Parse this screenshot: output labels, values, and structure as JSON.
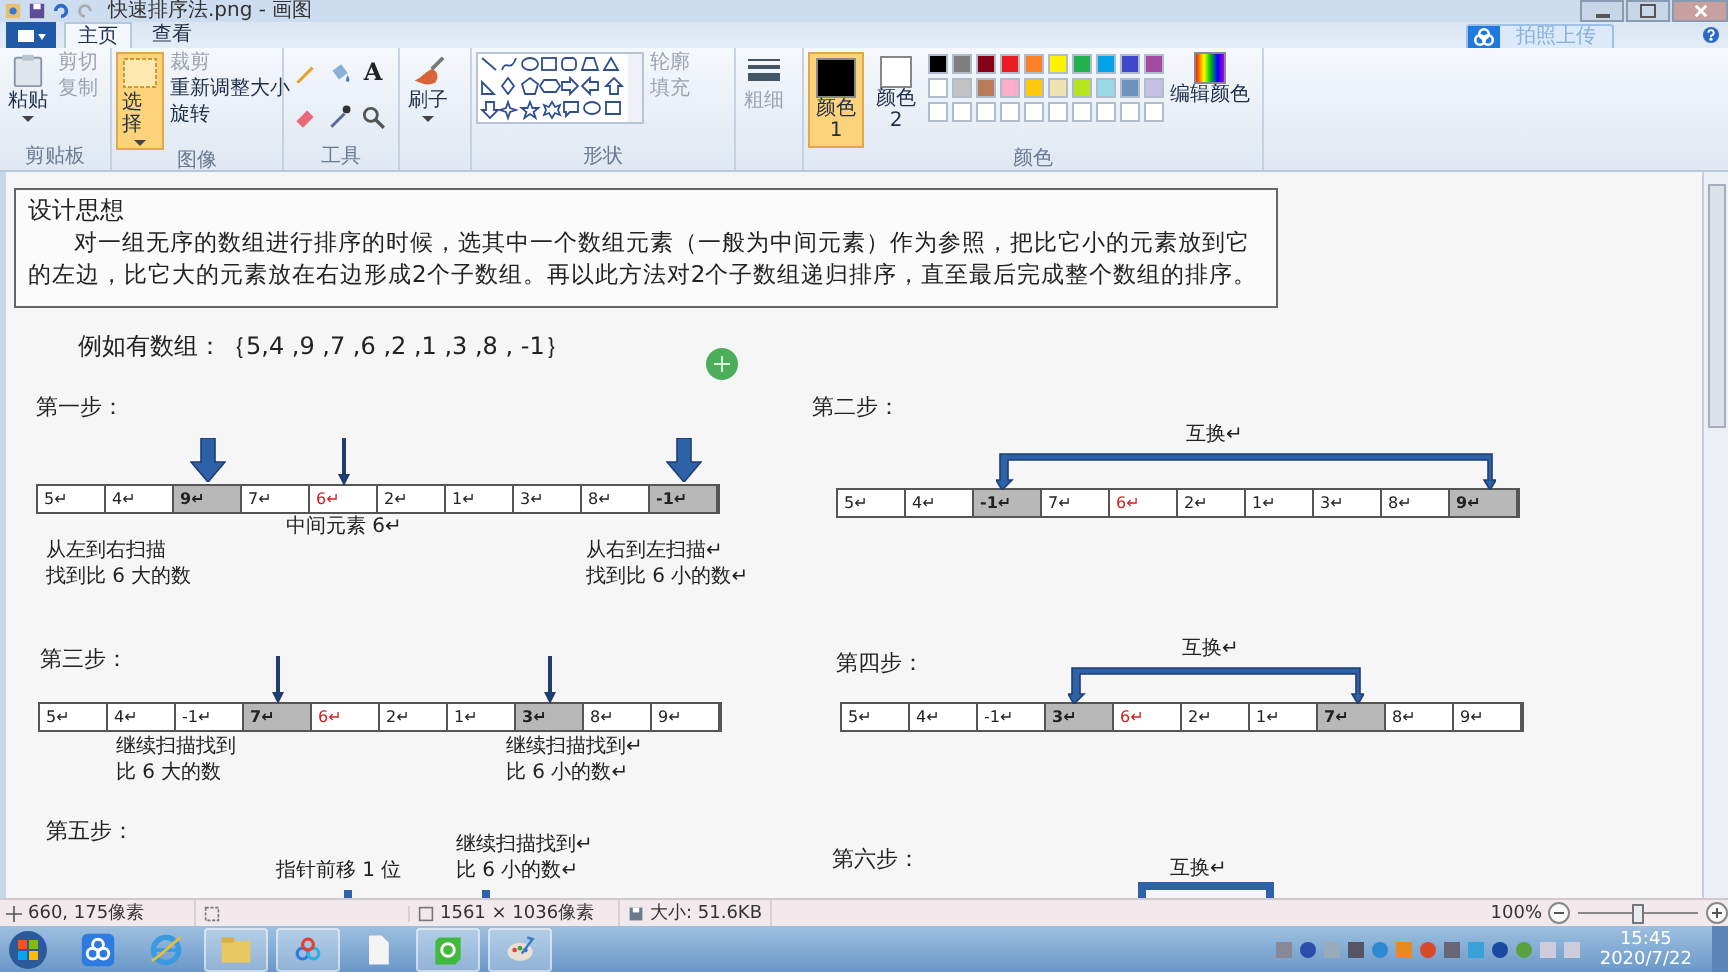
{
  "title_bar": {
    "title": "快速排序法.png - 画图"
  },
  "tabs": [
    {
      "label": "主页",
      "selected": true
    },
    {
      "label": "查看",
      "selected": false
    }
  ],
  "upload_button": {
    "label": "拍照上传"
  },
  "ribbon": {
    "clipboard": {
      "label": "剪贴板",
      "paste": "粘贴",
      "cut": {
        "label": "剪切",
        "disabled": true
      },
      "copy": {
        "label": "复制",
        "disabled": true
      }
    },
    "image": {
      "label": "图像",
      "select": {
        "label": "选择",
        "selected": true
      },
      "crop": {
        "label": "裁剪",
        "disabled": true
      },
      "resize": {
        "label": "重新调整大小",
        "disabled": false
      },
      "rotate": {
        "label": "旋转",
        "disabled": false
      }
    },
    "tools": {
      "label": "工具",
      "text_tool": "A"
    },
    "brushes": {
      "label": "刷子"
    },
    "shapes": {
      "label": "形状",
      "outline": {
        "label": "轮廓",
        "disabled": true
      },
      "fill": {
        "label": "填充",
        "disabled": true
      }
    },
    "size": {
      "label": "粗细",
      "disabled": true
    },
    "colors": {
      "label": "颜色",
      "color1": {
        "label": "颜色 1",
        "selected": true,
        "color": "#000000"
      },
      "color2": {
        "label": "颜色 2",
        "selected": false,
        "color": "#ffffff"
      },
      "edit": "编辑颜色",
      "palette": [
        {
          "color": "#000000"
        },
        {
          "color": "#7f7f7f"
        },
        {
          "color": "#880015"
        },
        {
          "color": "#ed1c24"
        },
        {
          "color": "#ff7f27"
        },
        {
          "color": "#fff200"
        },
        {
          "color": "#22b14c"
        },
        {
          "color": "#00a2e8"
        },
        {
          "color": "#3f48cc"
        },
        {
          "color": "#a349a4"
        },
        {
          "color": "#ffffff"
        },
        {
          "color": "#c3c3c3"
        },
        {
          "color": "#b97a57"
        },
        {
          "color": "#ffaec9"
        },
        {
          "color": "#ffc90e"
        },
        {
          "color": "#efe4b0"
        },
        {
          "color": "#b5e61d"
        },
        {
          "color": "#99d9ea"
        },
        {
          "color": "#7092be"
        },
        {
          "color": "#c8bfe7"
        },
        {
          "color": "#ffffff"
        },
        {
          "color": "#ffffff"
        },
        {
          "color": "#ffffff"
        },
        {
          "color": "#ffffff"
        },
        {
          "color": "#ffffff"
        },
        {
          "color": "#ffffff"
        },
        {
          "color": "#ffffff"
        },
        {
          "color": "#ffffff"
        },
        {
          "color": "#ffffff"
        },
        {
          "color": "#ffffff"
        }
      ]
    }
  },
  "document": {
    "intro": {
      "heading": "设计思想",
      "paragraph": "对一组无序的数组进行排序的时候，选其中一个数组元素（一般为中间元素）作为参照，把比它小的元素放到它的左边，比它大的元素放在右边形成2个子数组。再以此方法对2个子数组递归排序，直至最后完成整个数组的排序。"
    },
    "example": "例如有数组：｛5,4 ,9 ,7 ,6 ,2 ,1 ,3 ,8 , -1｝",
    "steps": [
      {
        "title": "第一步：",
        "kind": "scan",
        "cells": [
          {
            "text": "5↵",
            "highlighted": false,
            "pivot": false,
            "pointer": false
          },
          {
            "text": "4↵",
            "highlighted": false,
            "pivot": false,
            "pointer": false
          },
          {
            "text": "9↵",
            "highlighted": true,
            "pivot": false,
            "pointer": true,
            "thick_pointer": true
          },
          {
            "text": "7↵",
            "highlighted": false,
            "pivot": false,
            "pointer": false
          },
          {
            "text": "6↵",
            "highlighted": false,
            "pivot": true,
            "pointer": true,
            "thick_pointer": false
          },
          {
            "text": "2↵",
            "highlighted": false,
            "pivot": false,
            "pointer": false
          },
          {
            "text": "1↵",
            "highlighted": false,
            "pivot": false,
            "pointer": false
          },
          {
            "text": "3↵",
            "highlighted": false,
            "pivot": false,
            "pointer": false
          },
          {
            "text": "8↵",
            "highlighted": false,
            "pivot": false,
            "pointer": false
          },
          {
            "text": "-1↵",
            "highlighted": true,
            "pivot": false,
            "pointer": true,
            "thick_pointer": true
          }
        ],
        "notes": [
          {
            "lines": [
              "中间元素 6↵"
            ]
          },
          {
            "lines": [
              "从左到右扫描",
              "找到比 6 大的数"
            ]
          },
          {
            "lines": [
              "从右到左扫描↵",
              "找到比 6 小的数↵"
            ]
          }
        ]
      },
      {
        "title": "第二步：",
        "kind": "swap",
        "swap_label": "互换↵",
        "cells": [
          {
            "text": "5↵",
            "highlighted": false,
            "pivot": false
          },
          {
            "text": "4↵",
            "highlighted": false,
            "pivot": false
          },
          {
            "text": "-1↵",
            "highlighted": true,
            "pivot": false
          },
          {
            "text": "7↵",
            "highlighted": false,
            "pivot": false
          },
          {
            "text": "6↵",
            "highlighted": false,
            "pivot": true
          },
          {
            "text": "2↵",
            "highlighted": false,
            "pivot": false
          },
          {
            "text": "1↵",
            "highlighted": false,
            "pivot": false
          },
          {
            "text": "3↵",
            "highlighted": false,
            "pivot": false
          },
          {
            "text": "8↵",
            "highlighted": false,
            "pivot": false
          },
          {
            "text": "9↵",
            "highlighted": true,
            "pivot": false
          }
        ]
      },
      {
        "title": "第三步：",
        "kind": "scan",
        "cells": [
          {
            "text": "5↵",
            "highlighted": false,
            "pivot": false,
            "pointer": false
          },
          {
            "text": "4↵",
            "highlighted": false,
            "pivot": false,
            "pointer": false
          },
          {
            "text": "-1↵",
            "highlighted": false,
            "pivot": false,
            "pointer": false
          },
          {
            "text": "7↵",
            "highlighted": true,
            "pivot": false,
            "pointer": true,
            "thick_pointer": false
          },
          {
            "text": "6↵",
            "highlighted": false,
            "pivot": true,
            "pointer": false
          },
          {
            "text": "2↵",
            "highlighted": false,
            "pivot": false,
            "pointer": false
          },
          {
            "text": "1↵",
            "highlighted": false,
            "pivot": false,
            "pointer": false
          },
          {
            "text": "3↵",
            "highlighted": true,
            "pivot": false,
            "pointer": true,
            "thick_pointer": false
          },
          {
            "text": "8↵",
            "highlighted": false,
            "pivot": false,
            "pointer": false
          },
          {
            "text": "9↵",
            "highlighted": false,
            "pivot": false,
            "pointer": false
          }
        ],
        "notes": [
          {
            "lines": [
              "继续扫描找到",
              "比 6 大的数"
            ]
          },
          {
            "lines": [
              "继续扫描找到↵",
              "比 6 小的数↵"
            ]
          }
        ]
      },
      {
        "title": "第四步：",
        "kind": "swap",
        "swap_label": "互换↵",
        "cells": [
          {
            "text": "5↵",
            "highlighted": false,
            "pivot": false
          },
          {
            "text": "4↵",
            "highlighted": false,
            "pivot": false
          },
          {
            "text": "-1↵",
            "highlighted": false,
            "pivot": false
          },
          {
            "text": "3↵",
            "highlighted": true,
            "pivot": false
          },
          {
            "text": "6↵",
            "highlighted": false,
            "pivot": true
          },
          {
            "text": "2↵",
            "highlighted": false,
            "pivot": false
          },
          {
            "text": "1↵",
            "highlighted": false,
            "pivot": false
          },
          {
            "text": "7↵",
            "highlighted": true,
            "pivot": false
          },
          {
            "text": "8↵",
            "highlighted": false,
            "pivot": false
          },
          {
            "text": "9↵",
            "highlighted": false,
            "pivot": false
          }
        ]
      },
      {
        "title": "第五步：",
        "kind": "scan",
        "notes": [
          {
            "lines": [
              "指针前移 1 位"
            ]
          },
          {
            "lines": [
              "继续扫描找到↵",
              "比 6 小的数↵"
            ]
          }
        ]
      },
      {
        "title": "第六步：",
        "kind": "swap",
        "swap_label": "互换↵"
      }
    ]
  },
  "status_bar": {
    "cursor_position": "660, 175像素",
    "image_size": "1561 × 1036像素",
    "file_size": "大小: 51.6KB",
    "zoom": {
      "label": "100%",
      "level": 0.5
    }
  },
  "taskbar": {
    "time": "15:45",
    "date": "2020/7/22"
  }
}
